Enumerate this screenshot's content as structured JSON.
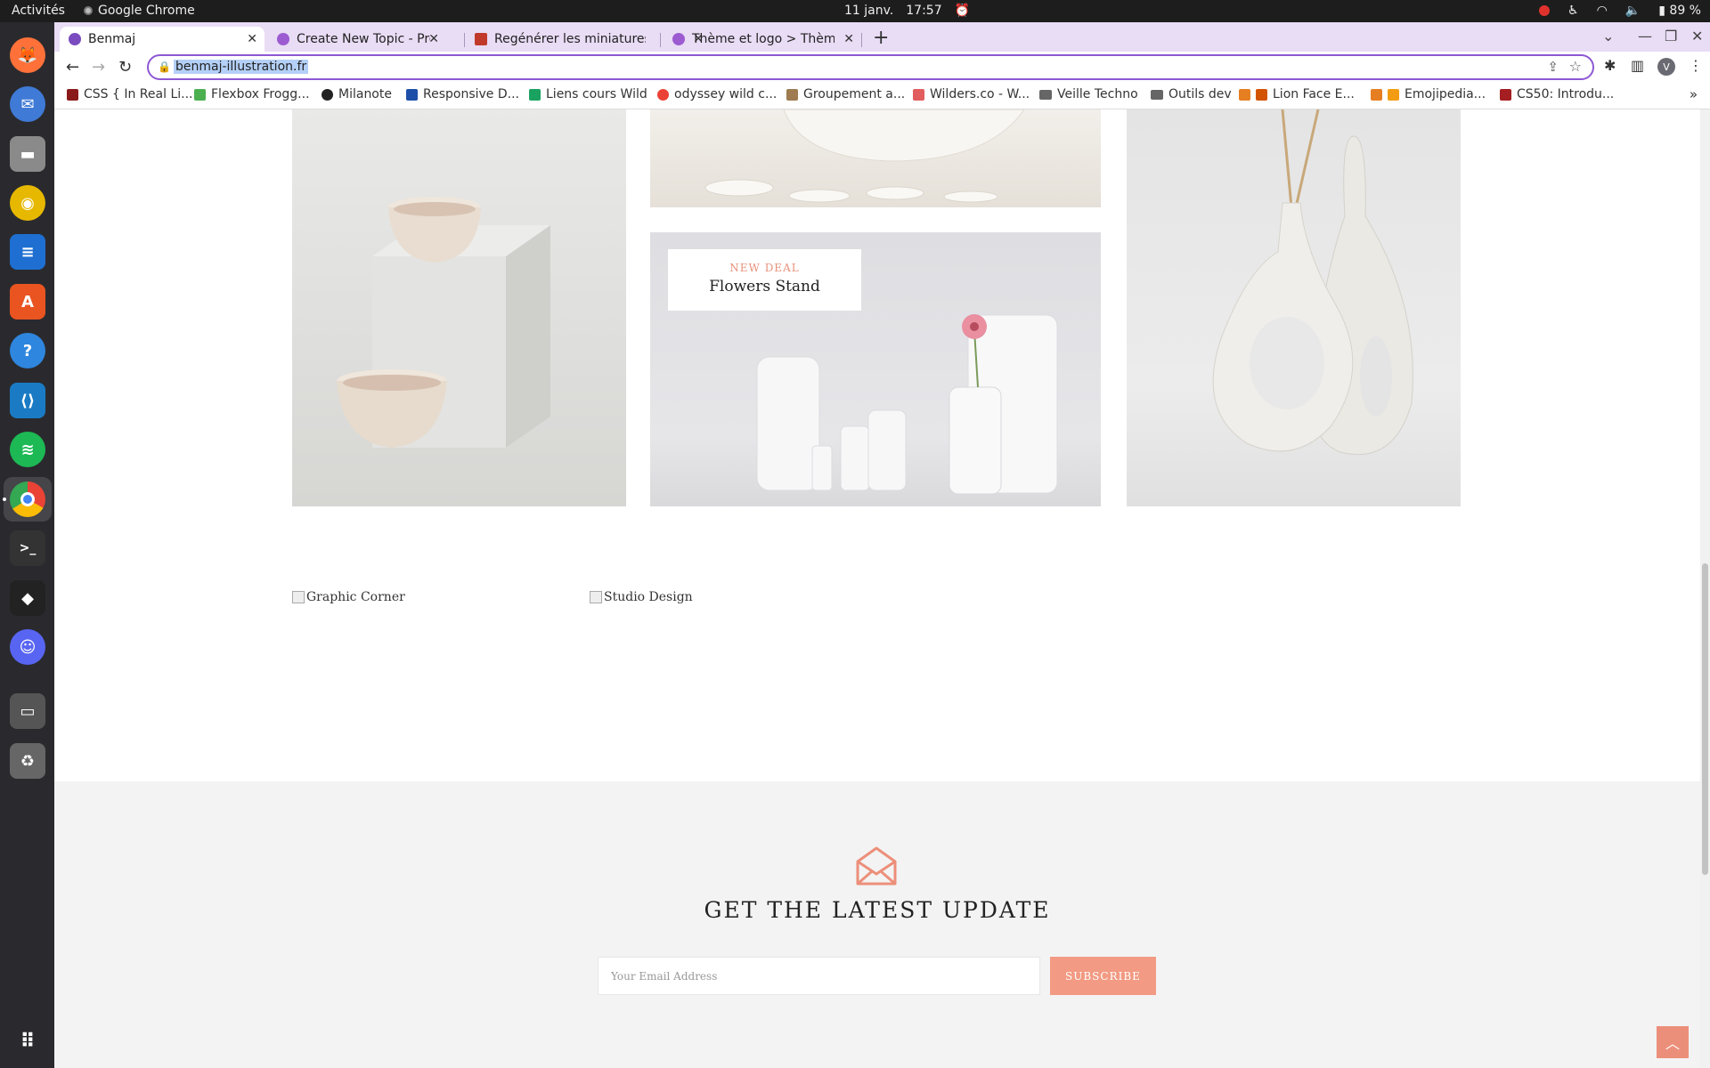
{
  "system": {
    "activities": "Activités",
    "app_name": "Google Chrome",
    "date": "11 janv.",
    "time": "17:57",
    "battery": "89 %"
  },
  "tabs": [
    {
      "label": "Benmaj",
      "favicon_color": "#7a4cc0"
    },
    {
      "label": "Create New Topic - Presta",
      "favicon_color": "#9c5bd1"
    },
    {
      "label": "Regénérer les miniatures",
      "favicon_color": "#c0392b"
    },
    {
      "label": "Thème et logo > Thème",
      "favicon_color": "#9c5bd1"
    }
  ],
  "omnibox": {
    "url": "benmaj-illustration.fr"
  },
  "profile_initial": "V",
  "bookmarks": [
    {
      "label": "CSS { In Real Li...",
      "color": "#8b1a1a"
    },
    {
      "label": "Flexbox Frogg...",
      "color": "#4caf50"
    },
    {
      "label": "Milanote",
      "color": "#222222"
    },
    {
      "label": "Responsive D...",
      "color": "#1e4fa8"
    },
    {
      "label": "Liens cours Wild",
      "color": "#1aa260"
    },
    {
      "label": "odyssey wild c...",
      "color": "#ea4335"
    },
    {
      "label": "Groupement a...",
      "color": "#9e7b50"
    },
    {
      "label": "Wilders.co - W...",
      "color": "#e25d5d"
    },
    {
      "label": "Veille Techno",
      "color": "folder"
    },
    {
      "label": "Outils dev",
      "color": "folder"
    },
    {
      "label": "Lion Face E...",
      "color": "#e67e22"
    },
    {
      "label": "Emojipedia...",
      "color": "#f39c12"
    },
    {
      "label": "CS50: Introdu...",
      "color": "#a41e22"
    }
  ],
  "page": {
    "deal": {
      "kicker": "NEW DEAL",
      "title": "Flowers Stand"
    },
    "broken_images": [
      "Graphic Corner",
      "Studio Design"
    ],
    "newsletter": {
      "title": "GET THE LATEST UPDATE",
      "email_placeholder": "Your Email Address",
      "subscribe_label": "SUBSCRIBE"
    }
  },
  "colors": {
    "accent": "#f29a83",
    "tab_bar": "#e9dcf5",
    "omnibox_border": "#8e58d4"
  }
}
